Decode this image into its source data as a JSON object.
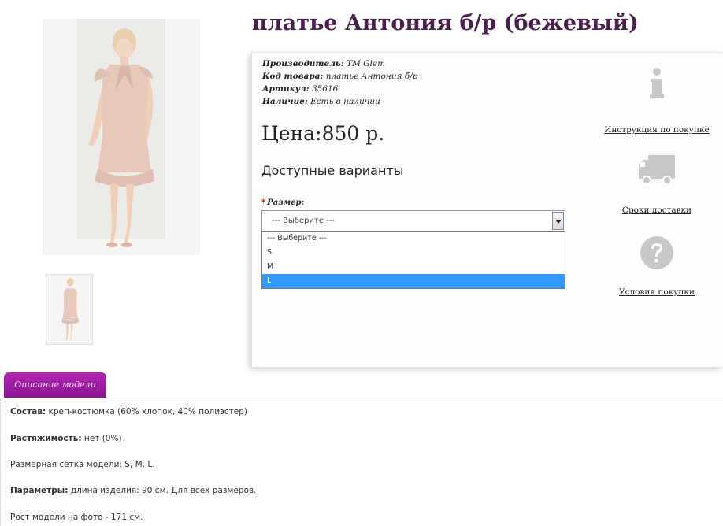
{
  "product": {
    "title": "платье Антония б/р (бежевый)",
    "meta": [
      {
        "key": "Производитель:",
        "value": "TM Glem"
      },
      {
        "key": "Код товара:",
        "value": "платье Антония б/р"
      },
      {
        "key": "Артикул:",
        "value": "35616"
      },
      {
        "key": "Наличие:",
        "value": "Есть в наличии"
      }
    ],
    "price": "Цена:850 р.",
    "variants_title": "Доступные варианты",
    "size_required_mark": "*",
    "size_label": "Размер:",
    "size_selected": "--- Выберите ---",
    "size_options": [
      "--- Выберите ---",
      "S",
      "M",
      "L"
    ],
    "size_highlighted_index": 3
  },
  "side_links": [
    {
      "label": "Инструкция по покупке",
      "icon": "info-icon"
    },
    {
      "label": "Сроки доставки",
      "icon": "truck-icon"
    },
    {
      "label": "Условия покупки",
      "icon": "question-icon"
    }
  ],
  "tab": {
    "label": "Описание модели"
  },
  "description": [
    {
      "key": "Состав:",
      "value": " креп-костюмка (60% хлопок, 40% полиэстер)"
    },
    {
      "key": "Растяжимость:",
      "value": " нет (0%)"
    },
    {
      "key": "",
      "value": "Размерная сетка модели: S, M, L."
    },
    {
      "key": "Параметры:",
      "value": " длина изделия: 90 см. Для всех размеров."
    },
    {
      "key": "",
      "value": "Рост модели на фото - 171 см."
    }
  ],
  "colors": {
    "title": "#4a1f4e",
    "tab": "#a01ea3",
    "highlight": "#3399ff",
    "icon": "#c8c8c8"
  }
}
